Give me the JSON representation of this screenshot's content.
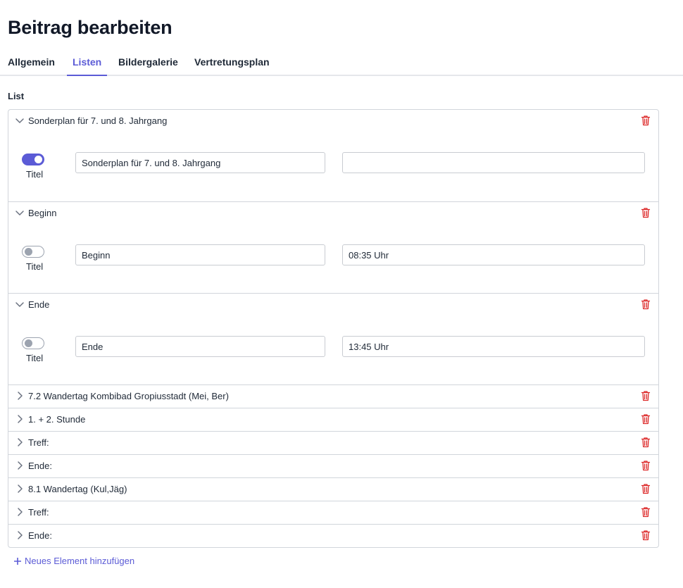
{
  "page": {
    "title": "Beitrag bearbeiten"
  },
  "tabs": [
    {
      "label": "Allgemein",
      "active": false
    },
    {
      "label": "Listen",
      "active": true
    },
    {
      "label": "Bildergalerie",
      "active": false
    },
    {
      "label": "Vertretungsplan",
      "active": false
    }
  ],
  "section": {
    "label": "List"
  },
  "items": [
    {
      "title": "Sonderplan für 7. und 8. Jahrgang",
      "expanded": true,
      "toggle_on": true,
      "toggle_label": "Titel",
      "key": "Sonderplan für 7. und 8. Jahrgang",
      "value": ""
    },
    {
      "title": "Beginn",
      "expanded": true,
      "toggle_on": false,
      "toggle_label": "Titel",
      "key": "Beginn",
      "value": "08:35 Uhr"
    },
    {
      "title": "Ende",
      "expanded": true,
      "toggle_on": false,
      "toggle_label": "Titel",
      "key": "Ende",
      "value": "13:45 Uhr"
    },
    {
      "title": "7.2 Wandertag Kombibad Gropiusstadt (Mei, Ber)",
      "expanded": false
    },
    {
      "title": "1. + 2. Stunde",
      "expanded": false
    },
    {
      "title": "Treff:",
      "expanded": false
    },
    {
      "title": "Ende:",
      "expanded": false
    },
    {
      "title": "8.1 Wandertag (Kul,Jäg)",
      "expanded": false
    },
    {
      "title": "Treff:",
      "expanded": false
    },
    {
      "title": "Ende:",
      "expanded": false
    }
  ],
  "add_button": {
    "label": "Neues Element hinzufügen"
  },
  "colors": {
    "accent": "#5b5bd6",
    "danger": "#dc2626",
    "border": "#d1d5db"
  },
  "icons": {
    "collapse": "chevron-down-icon",
    "expand": "chevron-right-icon",
    "delete": "trash-icon",
    "add": "plus-icon"
  }
}
